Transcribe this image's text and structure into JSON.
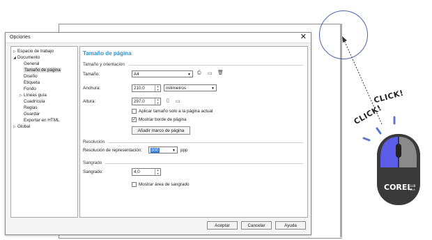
{
  "dialog": {
    "title": "Opciones",
    "buttons": {
      "ok": "Aceptar",
      "cancel": "Cancelar",
      "help": "Ayuda"
    }
  },
  "tree": {
    "items": [
      "Espacio de trabajo",
      "Documento",
      "General",
      "Tamaño de página",
      "Diseño",
      "Etiqueta",
      "Fondo",
      "Líneas guía",
      "Cuadrícula",
      "Reglas",
      "Guardar",
      "Exportar en HTML",
      "Global"
    ],
    "selected": "Tamaño de página"
  },
  "panel": {
    "title": "Tamaño de página",
    "size_section": "Tamaño y orientación",
    "size_label": "Tamaño:",
    "size_value": "A4",
    "width_label": "Anchura:",
    "width_value": "210,0",
    "units_value": "milímetros",
    "height_label": "Altura:",
    "height_value": "297,0",
    "apply_current": "Aplicar tamaño solo a la página actual",
    "show_border": "Mostrar borde de página",
    "add_frame": "Añadir marco de página",
    "resolution_section": "Resolución",
    "resolution_label": "Resolución de representación:",
    "resolution_value": "300",
    "resolution_unit": "ppp",
    "bleed_section": "Sangrado",
    "bleed_label": "Sangrado:",
    "bleed_value": "4,0",
    "show_bleed": "Mostrar área de sangrado"
  },
  "annotation": {
    "click1": "CLICK!",
    "click2": "CLICK!",
    "logo": "COREL",
    "logo_sub": "CLUB",
    "logo_small": "HOLA"
  },
  "colors": {
    "accent": "#2c8fc7",
    "circle": "#4a63b2",
    "mouse_button": "#5b5de8"
  }
}
